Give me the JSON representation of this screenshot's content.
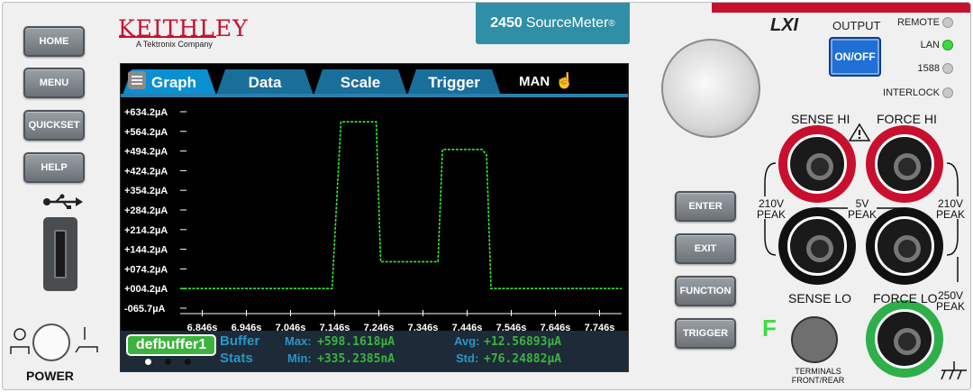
{
  "brand": {
    "name": "KEITHLEY",
    "sub": "A Tektronix Company"
  },
  "model": {
    "number": "2450",
    "name": "SourceMeter",
    "mark": "®"
  },
  "left_buttons": [
    "HOME",
    "MENU",
    "QUICKSET",
    "HELP"
  ],
  "power_label": "POWER",
  "tabs": [
    {
      "label": "Graph",
      "active": true
    },
    {
      "label": "Data"
    },
    {
      "label": "Scale"
    },
    {
      "label": "Trigger"
    }
  ],
  "range_mode": "MAN",
  "chart_data": {
    "type": "line",
    "y_tick_labels": [
      "+634.2µA",
      "+564.2µA",
      "+494.2µA",
      "+424.2µA",
      "+354.2µA",
      "+284.2µA",
      "+214.2µA",
      "+144.2µA",
      "+074.2µA",
      "+004.2µA",
      "-065.7µA"
    ],
    "x_tick_labels": [
      "6.846s",
      "6.946s",
      "7.046s",
      "7.146s",
      "7.246s",
      "7.346s",
      "7.446s",
      "7.546s",
      "7.646s",
      "7.746s"
    ],
    "ylim": [
      -65.7,
      634.2
    ],
    "xlim": [
      6.796,
      7.796
    ],
    "grid": false,
    "series": [
      {
        "color": "#39e639",
        "x": [
          6.796,
          7.14,
          7.16,
          7.17,
          7.24,
          7.25,
          7.26,
          7.38,
          7.39,
          7.4,
          7.48,
          7.49,
          7.5,
          7.52,
          7.796
        ],
        "y": [
          4.2,
          4.2,
          598.2,
          598.2,
          598.2,
          100,
          100,
          100,
          500,
          500,
          500,
          480,
          4.2,
          4.2,
          4.2
        ]
      }
    ]
  },
  "buffer": {
    "name": "defbuffer1",
    "label1": "Buffer",
    "label2": "Stats",
    "max_label": "Max:",
    "max_value": "+598.1618µA",
    "min_label": "Min:",
    "min_value": "+335.2385nA",
    "avg_label": "Avg:",
    "avg_value": "+12.56893µA",
    "std_label": "Std:",
    "std_value": "+76.24882µA"
  },
  "lxi_label": "LXI",
  "output_label": "OUTPUT",
  "onoff_label": "ON/OFF",
  "indicators": [
    {
      "label": "REMOTE",
      "color": "#c8c8c8"
    },
    {
      "label": "LAN",
      "color": "#3ddc3d"
    },
    {
      "label": "1588",
      "color": "#c8c8c8"
    },
    {
      "label": "INTERLOCK",
      "color": "#c8c8c8"
    }
  ],
  "right_buttons": [
    "ENTER",
    "EXIT",
    "FUNCTION",
    "TRIGGER"
  ],
  "terminals": {
    "sense_hi": "SENSE HI",
    "force_hi": "FORCE HI",
    "sense_lo": "SENSE LO",
    "force_lo": "FORCE LO",
    "peak_left": "210V\nPEAK",
    "peak_mid": "5V\nPEAK",
    "peak_right": "210V\nPEAK",
    "peak_bottom": "250V\nPEAK"
  },
  "front_rear_letter": "F",
  "terminals_select_label": "TERMINALS\nFRONT/REAR"
}
